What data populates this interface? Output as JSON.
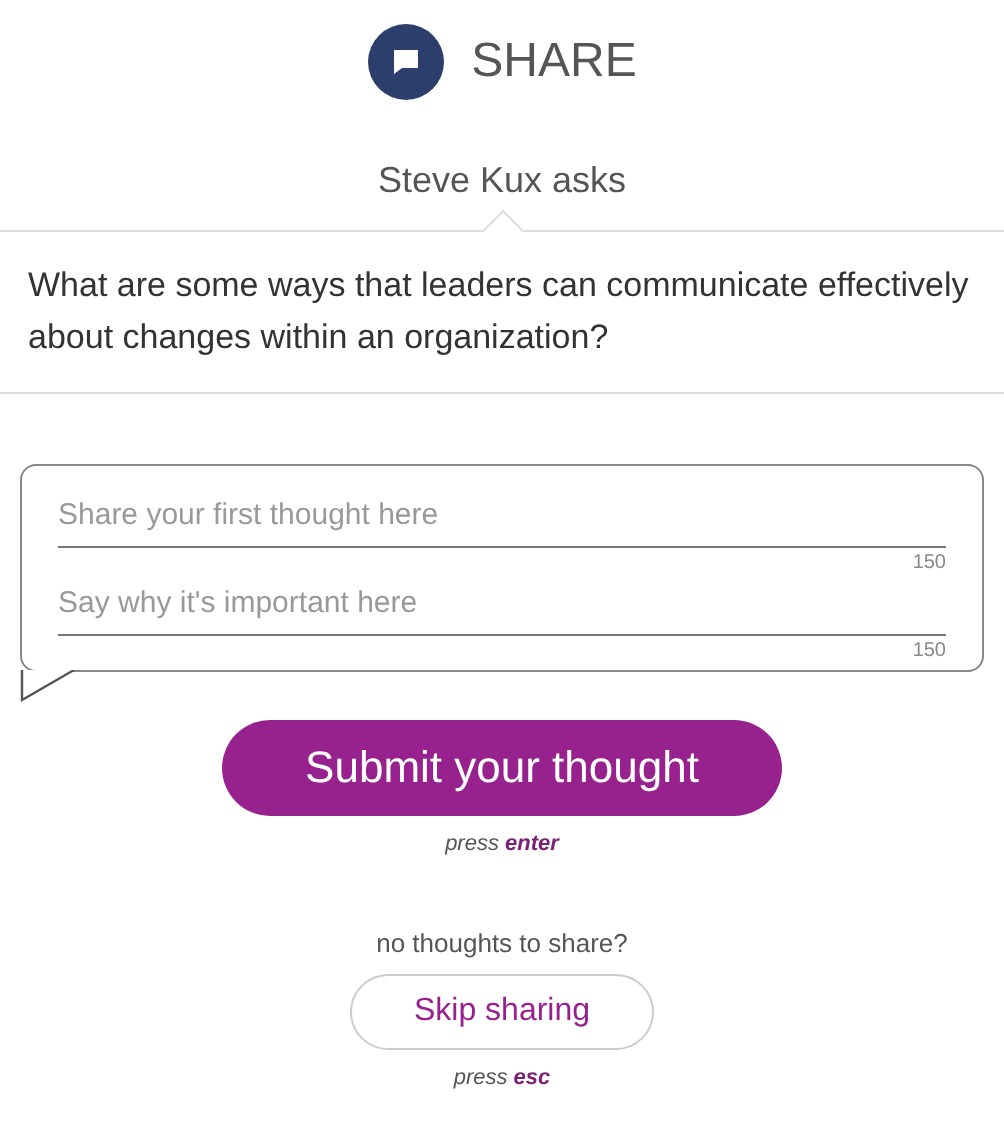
{
  "header": {
    "title": "SHARE"
  },
  "asker": "Steve Kux asks",
  "question": "What are some ways that leaders can communicate effectively about changes within an organization?",
  "fields": [
    {
      "placeholder": "Share your first thought here",
      "counter": "150"
    },
    {
      "placeholder": "Say why it's important here",
      "counter": "150"
    }
  ],
  "submit": {
    "label": "Submit your thought",
    "hint": "press **enter**"
  },
  "skip": {
    "prompt": "no thoughts to share?",
    "label": "Skip sharing",
    "hint": "press **esc**"
  }
}
